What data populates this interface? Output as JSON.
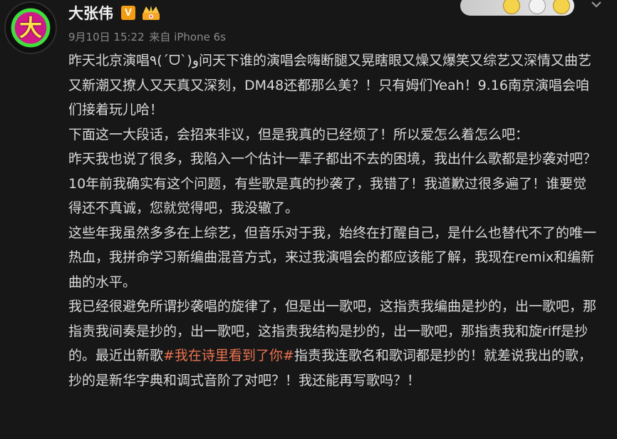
{
  "user": {
    "name": "大张伟",
    "avatar_glyph": "大",
    "verified_label": "V",
    "crown_icon": "crown-icon"
  },
  "meta": {
    "date": "9月10日 15:22",
    "source": "来自 iPhone 6s"
  },
  "post": {
    "p1": "昨天北京演唱٩(ˊᗜˋ)و问天下谁的演唱会嗨断腿又晃瞎眼又燥又爆笑又综艺又深情又曲艺又新潮又撩人又天真又深刻，DM48还都那么美？！只有姆们Yeah！9.16南京演唱会咱们接着玩儿哈！",
    "p2": "下面这一大段话，会招来非议，但是我真的已经烦了！所以爱怎么着怎么吧：",
    "p3": "昨天我也说了很多，我陷入一个估计一辈子都出不去的困境，我出什么歌都是抄袭对吧？",
    "p4": "10年前我确实有这个问题，有些歌是真的抄袭了，我错了！我道歉过很多遍了！谁要觉得还不真诚，您就觉得吧，我没辙了。",
    "p5": "这些年我虽然多多在上综艺，但音乐对于我，始终在打醒自己，是什么也替代不了的唯一热血，我拼命学习新编曲混音方式，来过我演唱会的都应该能了解，我现在remix和编新曲的水平。",
    "p6_before": "我已经很避免所谓抄袭唱的旋律了，但是出一歌吧，这指责我编曲是抄的，出一歌吧，那指责我间奏是抄的，出一歌吧，这指责我结构是抄的，出一歌吧，那指责我和旋riff是抄的。最近出新歌",
    "p6_hashtag": "#我在诗里看到了你#",
    "p6_after": "指责我连歌名和歌词都是抄的！就差说我出的歌，抄的是新华字典和调式音阶了对吧？！我还能再写歌吗？！"
  },
  "colors": {
    "background": "#171717",
    "text": "#dadada",
    "hashtag": "#eb7350",
    "meta": "#8a8a8a",
    "verified": "#f39c12"
  }
}
